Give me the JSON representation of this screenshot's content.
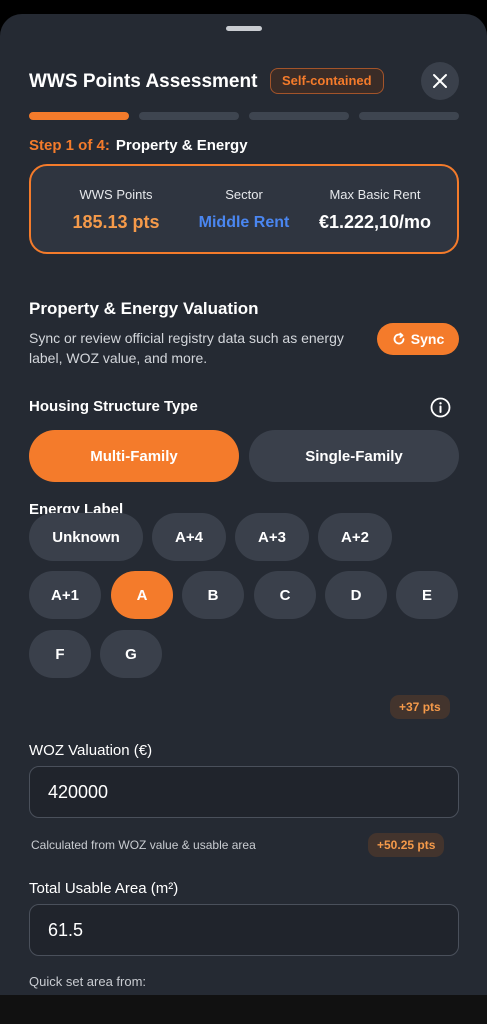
{
  "header": {
    "title": "WWS Points Assessment",
    "badge": "Self-contained"
  },
  "progress": {
    "current_step": 1,
    "total_steps": 4
  },
  "step": {
    "number_label": "Step 1 of 4:",
    "name": "Property & Energy"
  },
  "summary": {
    "points_label": "WWS Points",
    "points_value": "185.13 pts",
    "sector_label": "Sector",
    "sector_value": "Middle Rent",
    "rent_label": "Max Basic Rent",
    "rent_value": "€1.222,10/mo"
  },
  "section": {
    "title": "Property & Energy Valuation",
    "description": "Sync or review official registry data such as energy label, WOZ value, and more.",
    "sync_label": "Sync"
  },
  "housing": {
    "label": "Housing Structure Type",
    "options": [
      "Multi-Family",
      "Single-Family"
    ],
    "selected": "Multi-Family"
  },
  "energy": {
    "label": "Energy Label",
    "options": [
      "Unknown",
      "A+4",
      "A+3",
      "A+2",
      "A+1",
      "A",
      "B",
      "C",
      "D",
      "E",
      "F",
      "G"
    ],
    "selected": "A",
    "points_badge": "+37 pts"
  },
  "woz": {
    "label": "WOZ Valuation (€)",
    "value": "420000",
    "hint": "Calculated from WOZ value & usable area",
    "points_badge": "+50.25 pts"
  },
  "area": {
    "label": "Total Usable Area (m²)",
    "value": "61.5",
    "quick_set_label": "Quick set area from:"
  },
  "colors": {
    "accent": "#f47b2b",
    "sector": "#4a86f0",
    "background": "#252a33",
    "chip": "#3a404b"
  }
}
